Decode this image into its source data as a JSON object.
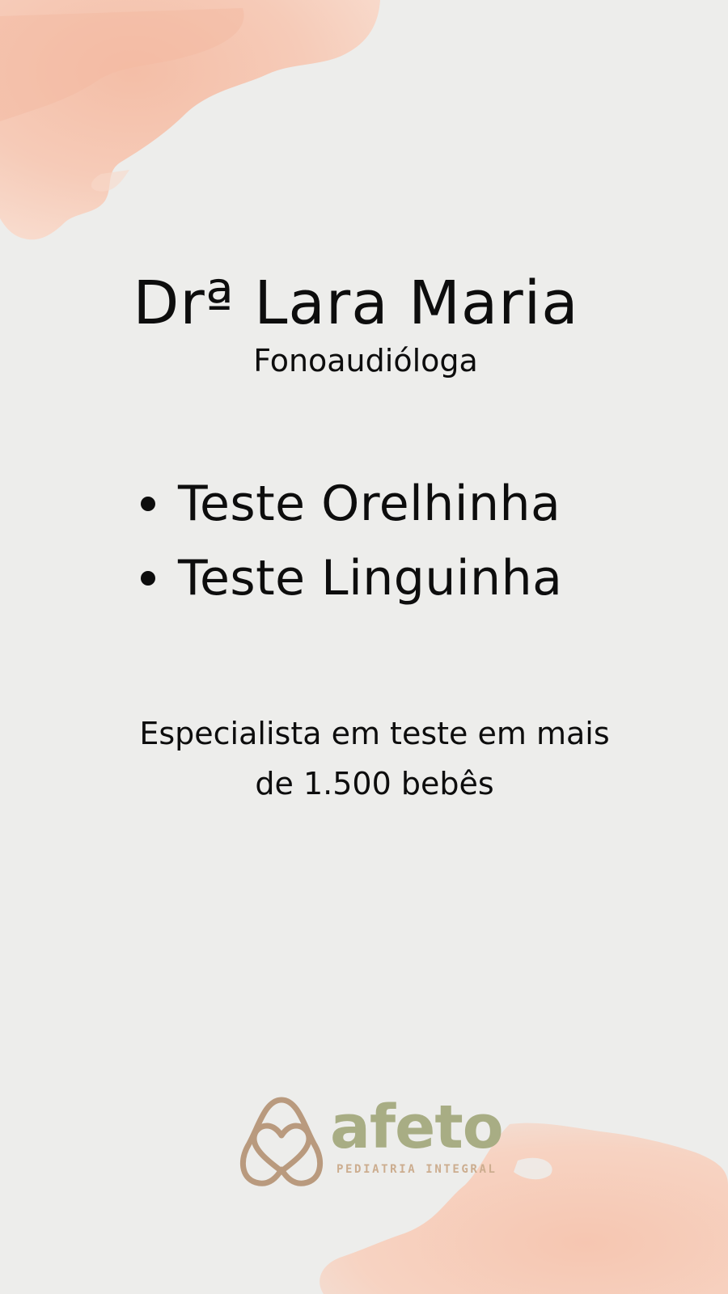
{
  "colors": {
    "background": "#ededeb",
    "watercolor": "#f5c9b7",
    "text": "#0d0d0d",
    "logo_mark": "#b99a7e",
    "logo_word": "#a8ad84",
    "logo_tagline": "#ccad8f"
  },
  "profile": {
    "name": "Drª Lara Maria",
    "role": "Fonoaudióloga"
  },
  "services": [
    {
      "label": "Teste Orelhinha"
    },
    {
      "label": "Teste Linguinha"
    }
  ],
  "specialty": {
    "line1": "Especialista em teste em mais",
    "line2": "de 1.500 bebês"
  },
  "brand": {
    "name": "afeto",
    "tagline": "PEDIATRIA INTEGRAL",
    "icon": "heart-icon"
  }
}
